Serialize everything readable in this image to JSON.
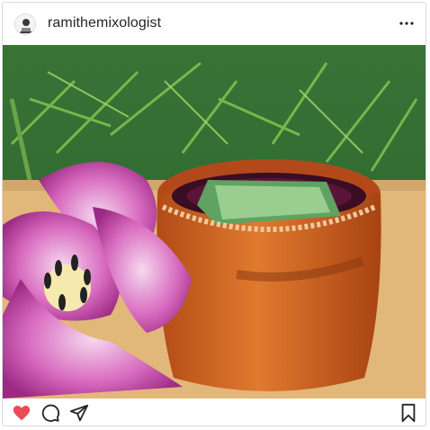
{
  "header": {
    "username": "ramithemixologist",
    "avatar_icon": "profile-avatar-icon",
    "more_icon": "more-options-icon"
  },
  "photo": {
    "subject_icon": "post-photo"
  },
  "actions": {
    "like_icon": "heart-icon",
    "comment_icon": "comment-icon",
    "share_icon": "share-icon",
    "save_icon": "bookmark-icon"
  },
  "colors": {
    "like": "#ed4956",
    "text": "#262626",
    "border": "#dbdbdb"
  }
}
